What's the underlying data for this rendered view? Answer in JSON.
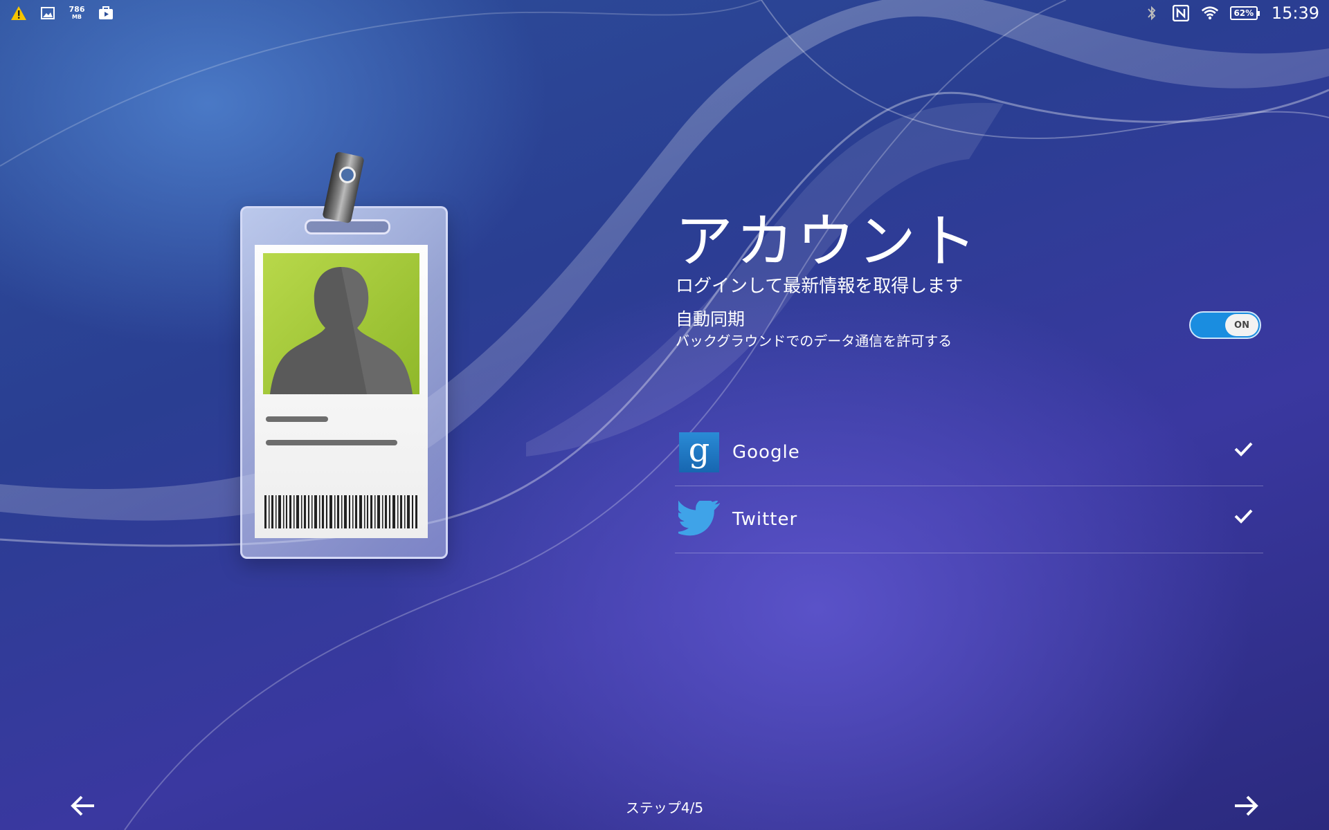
{
  "status_bar": {
    "left_icons": [
      "warning-icon",
      "image-icon",
      "memory-indicator",
      "media-icon"
    ],
    "memory_value": "786",
    "memory_unit": "MB",
    "right_icons": [
      "bluetooth-icon",
      "nfc-icon",
      "wifi-icon",
      "battery-icon"
    ],
    "battery": "62%",
    "time": "15:39",
    "warning_color": "#f5c400"
  },
  "badge": {
    "photo_color": "#a6c93a",
    "icons": [
      "badge-clip-icon",
      "person-silhouette-icon",
      "barcode-icon"
    ]
  },
  "page": {
    "title": "アカウント",
    "subtitle": "ログインして最新情報を取得します"
  },
  "auto_sync": {
    "title": "自動同期",
    "description": "バックグラウンドでのデータ通信を許可する",
    "toggle_label": "ON",
    "toggle_state": true,
    "accent": "#1a8de0"
  },
  "accounts": [
    {
      "name": "Google",
      "icon": "google-icon",
      "checked": true
    },
    {
      "name": "Twitter",
      "icon": "twitter-icon",
      "checked": true
    }
  ],
  "footer": {
    "step": "ステップ4/5",
    "back_icon": "arrow-left-icon",
    "next_icon": "arrow-right-icon"
  }
}
